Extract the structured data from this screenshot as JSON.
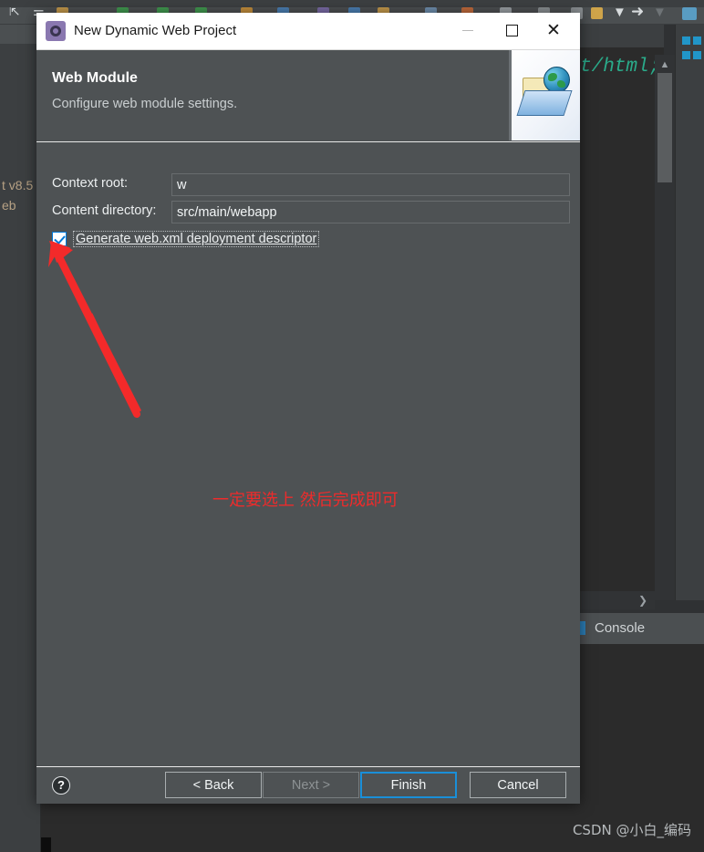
{
  "dialog": {
    "title": "New Dynamic Web Project",
    "icon": "gear-icon",
    "heading": "Web Module",
    "subheading": "Configure web module settings.",
    "banner_icon": "folder-globe-icon",
    "window_controls": {
      "minimize": "minimize-icon",
      "maximize": "maximize-icon",
      "close": "close-icon"
    },
    "fields": [
      {
        "label": "Context root:",
        "value": "w",
        "name": "context-root"
      },
      {
        "label": "Content directory:",
        "value": "src/main/webapp",
        "name": "content-directory"
      }
    ],
    "checkbox": {
      "label": "Generate web.xml deployment descriptor",
      "checked": true
    },
    "annotation": {
      "text": "一定要选上 然后完成即可",
      "color": "#ee2b2b",
      "arrow": "red-arrow-pointing-to-checkbox"
    },
    "footer": {
      "help": "?",
      "buttons": [
        {
          "label": "< Back",
          "name": "back-button",
          "state": "enabled"
        },
        {
          "label": "Next >",
          "name": "next-button",
          "state": "disabled"
        },
        {
          "label": "Finish",
          "name": "finish-button",
          "state": "default"
        },
        {
          "label": "Cancel",
          "name": "cancel-button",
          "state": "enabled"
        }
      ]
    }
  },
  "background": {
    "left_panel_text_1": "t v8.5",
    "left_panel_text_2": "eb",
    "editor_code": "t/html;",
    "console_label": "Console",
    "scroll_up": "▲",
    "scroll_right": "❯"
  },
  "watermark": "CSDN @小白_编码",
  "colors": {
    "dialog_body": "#4e5254",
    "titlebar": "#ffffff",
    "accent_blue": "#0078d7",
    "annotation_red": "#ee2b2b",
    "ide_background": "#2b2b2b"
  }
}
